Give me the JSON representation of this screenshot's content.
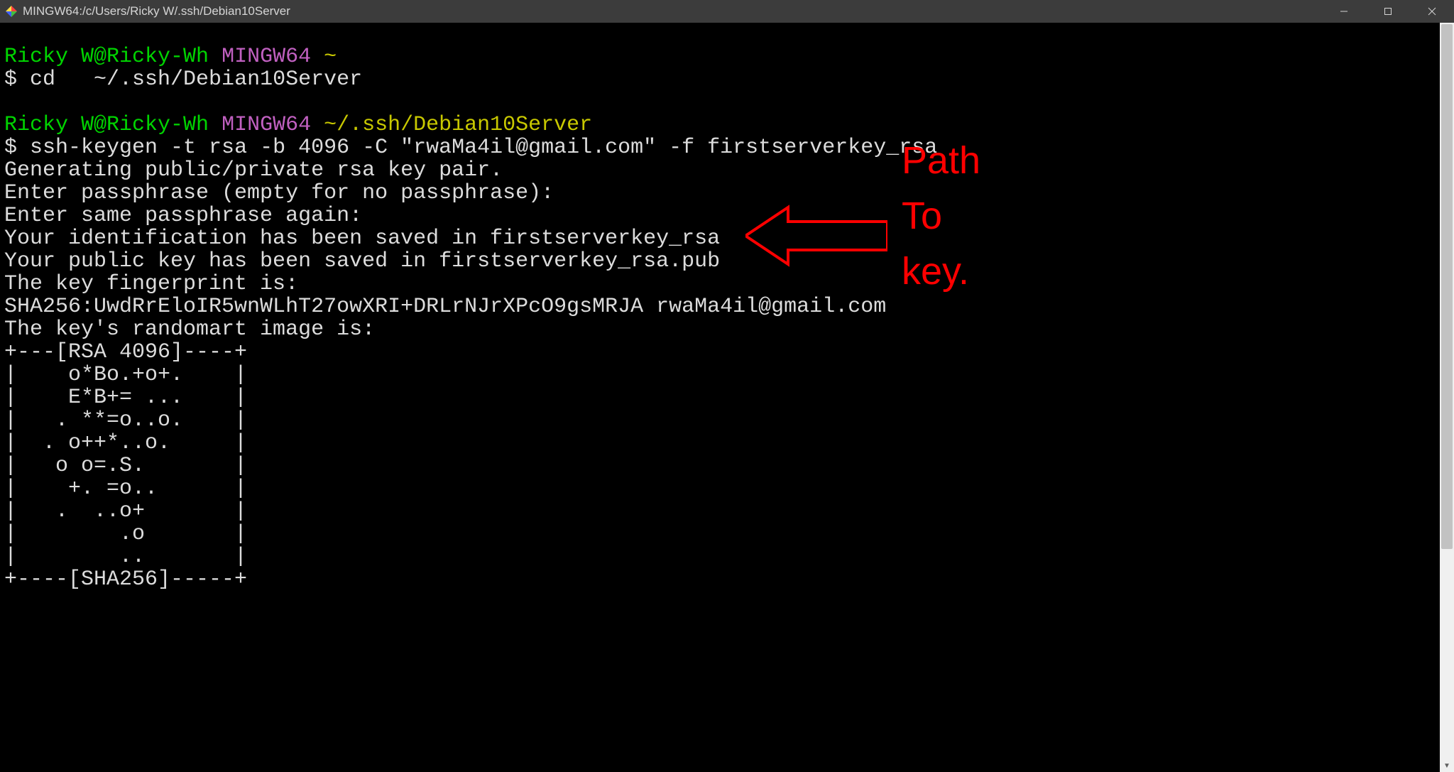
{
  "window": {
    "title": "MINGW64:/c/Users/Ricky W/.ssh/Debian10Server"
  },
  "prompt1": {
    "user_host": "Ricky W@Ricky-Wh",
    "env": "MINGW64",
    "path": "~",
    "cmd_prefix": "$ ",
    "cmd": "cd   ~/.ssh/Debian10Server"
  },
  "prompt2": {
    "user_host": "Ricky W@Ricky-Wh",
    "env": "MINGW64",
    "path": "~/.ssh/Debian10Server",
    "cmd_prefix": "$ ",
    "cmd": "ssh-keygen -t rsa -b 4096 -C \"rwaMa4il@gmail.com\" -f firstserverkey_rsa"
  },
  "out": {
    "l01": "Generating public/private rsa key pair.",
    "l02": "Enter passphrase (empty for no passphrase):",
    "l03": "Enter same passphrase again:",
    "l04": "Your identification has been saved in firstserverkey_rsa",
    "l05": "Your public key has been saved in firstserverkey_rsa.pub",
    "l06": "The key fingerprint is:",
    "l07": "SHA256:UwdRrEloIR5wnWLhT27owXRI+DRLrNJrXPcO9gsMRJA rwaMa4il@gmail.com",
    "l08": "The key's randomart image is:",
    "art01": "+---[RSA 4096]----+",
    "art02": "|    o*Bo.+o+.    |",
    "art03": "|    E*B+= ...    |",
    "art04": "|   . **=o..o.    |",
    "art05": "|  . o++*..o.     |",
    "art06": "|   o o=.S.       |",
    "art07": "|    +. =o..      |",
    "art08": "|   .  ..o+       |",
    "art09": "|        .o       |",
    "art10": "|        ..       |",
    "art11": "+----[SHA256]-----+"
  },
  "annotation": {
    "line1": "Path",
    "line2": "To",
    "line3": "key."
  }
}
